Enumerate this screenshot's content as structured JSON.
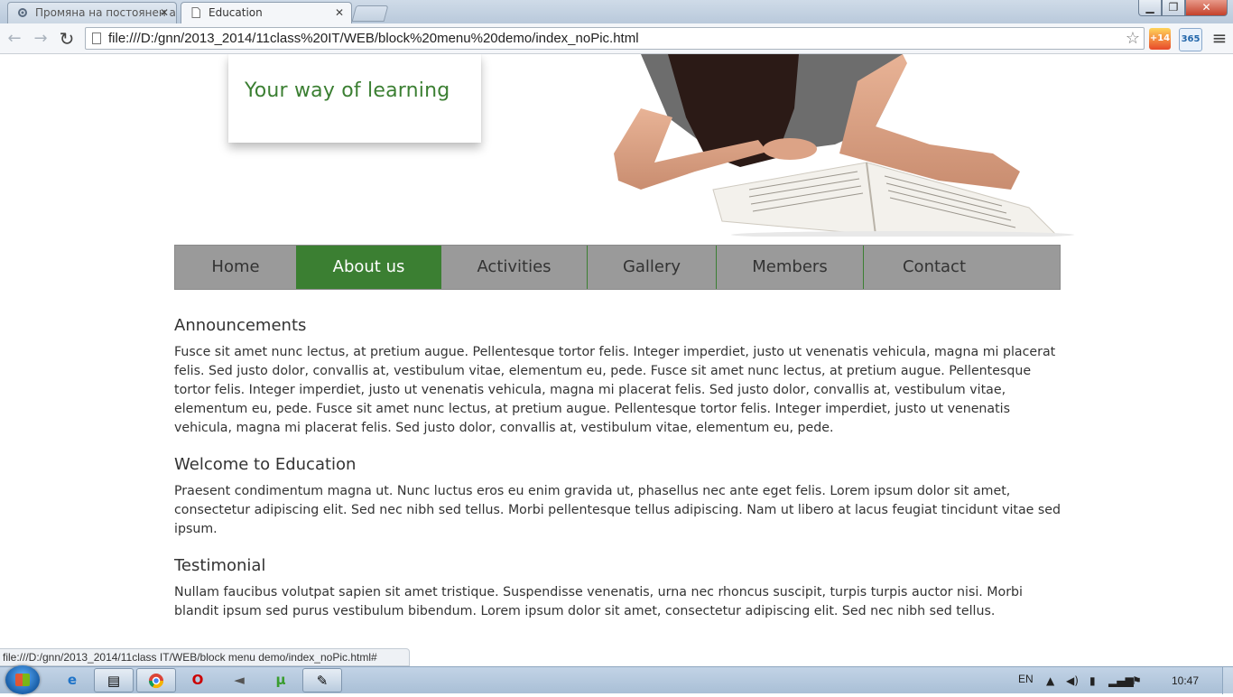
{
  "browser": {
    "tabs": [
      {
        "title": "Промяна на постоянен а",
        "active": false
      },
      {
        "title": "Education",
        "active": true
      }
    ],
    "address": "file:///D:/gnn/2013_2014/11class%20IT/WEB/block%20menu%20demo/index_noPic.html",
    "extension_badge": "+14",
    "extension_365": "365",
    "status_url": "file:///D:/gnn/2013_2014/11class IT/WEB/block menu demo/index_noPic.html#"
  },
  "site": {
    "slogan": "Your way of learning",
    "menu": [
      {
        "label": "Home"
      },
      {
        "label": "About us"
      },
      {
        "label": "Activities"
      },
      {
        "label": "Gallery"
      },
      {
        "label": "Members"
      },
      {
        "label": "Contact"
      }
    ],
    "active_menu": "About us",
    "accent_color": "#3b7f32",
    "menu_color": "#9a9a9a"
  },
  "content": {
    "sections": [
      {
        "heading": "Announcements",
        "text": "Fusce sit amet nunc lectus, at pretium augue. Pellentesque tortor felis. Integer imperdiet, justo ut venenatis vehicula, magna mi placerat felis. Sed justo dolor, convallis at, vestibulum vitae, elementum eu, pede. Fusce sit amet nunc lectus, at pretium augue. Pellentesque tortor felis. Integer imperdiet, justo ut venenatis vehicula, magna mi placerat felis. Sed justo dolor, convallis at, vestibulum vitae, elementum eu, pede. Fusce sit amet nunc lectus, at pretium augue. Pellentesque tortor felis. Integer imperdiet, justo ut venenatis vehicula, magna mi placerat felis. Sed justo dolor, convallis at, vestibulum vitae, elementum eu, pede."
      },
      {
        "heading": "Welcome to Education",
        "text": "Praesent condimentum magna ut. Nunc luctus eros eu enim gravida ut, phasellus nec ante eget felis. Lorem ipsum dolor sit amet, consectetur adipiscing elit. Sed nec nibh sed tellus. Morbi pellentesque tellus adipiscing. Nam ut libero at lacus feugiat tincidunt vitae sed ipsum."
      },
      {
        "heading": "Testimonial",
        "text": "Nullam faucibus volutpat sapien sit amet tristique. Suspendisse venenatis, urna nec rhoncus suscipit, turpis turpis auctor nisi. Morbi blandit ipsum sed purus vestibulum bibendum. Lorem ipsum dolor sit amet, consectetur adipiscing elit. Sed nec nibh sed tellus."
      }
    ]
  },
  "taskbar": {
    "language": "EN",
    "time": "10:47"
  }
}
